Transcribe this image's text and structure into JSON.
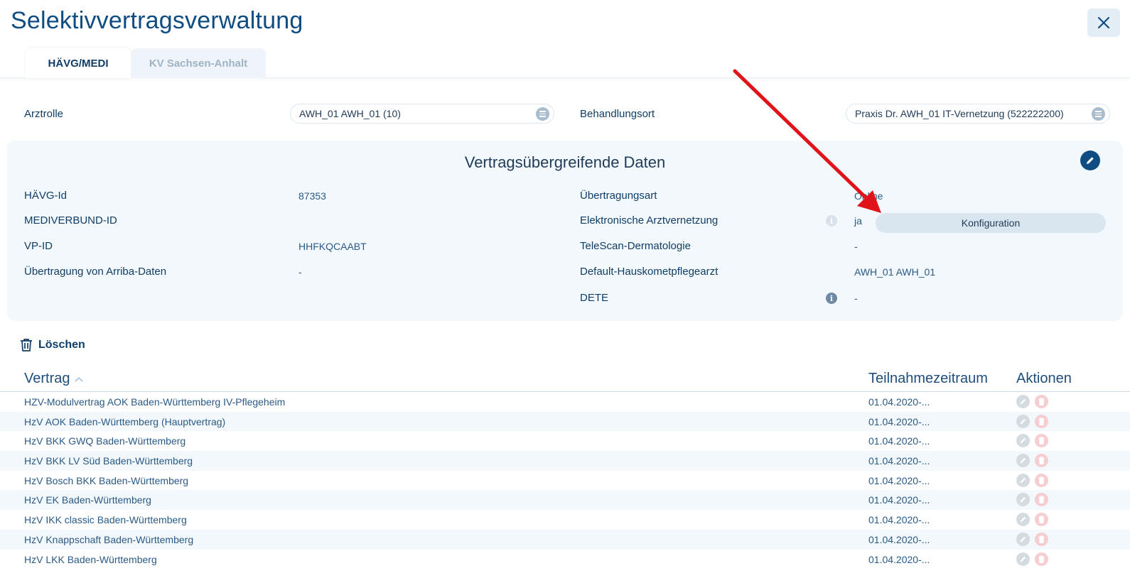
{
  "window": {
    "title": "Selektivvertragsverwaltung"
  },
  "tabs": [
    {
      "label": "HÄVG/MEDI",
      "active": true
    },
    {
      "label": "KV Sachsen-Anhalt",
      "active": false
    }
  ],
  "filters": {
    "arztrolle_label": "Arztrolle",
    "arztrolle_value": "AWH_01 AWH_01 (10)",
    "behandlungsort_label": "Behandlungsort",
    "behandlungsort_value": "Praxis Dr. AWH_01 IT-Vernetzung (522222200)"
  },
  "panel": {
    "title": "Vertragsübergreifende Daten",
    "left": [
      {
        "label": "HÄVG-Id",
        "value": "87353"
      },
      {
        "label": "MEDIVERBUND-ID",
        "value": ""
      },
      {
        "label": "VP-ID",
        "value": "HHFKQCAABT"
      },
      {
        "label": "Übertragung von Arriba-Daten",
        "value": "-"
      }
    ],
    "right": [
      {
        "label": "Übertragungsart",
        "value": "Online"
      },
      {
        "label": "Elektronische Arztvernetzung",
        "value": "ja"
      },
      {
        "label": "TeleScan-Dermatologie",
        "value": "-"
      },
      {
        "label": "Default-Hauskometpflegearzt",
        "value": "AWH_01 AWH_01"
      },
      {
        "label": "DETE",
        "value": "-"
      }
    ],
    "konfiguration_label": "Konfiguration"
  },
  "toolbar": {
    "delete_label": "Löschen"
  },
  "table": {
    "col_vertrag": "Vertrag",
    "col_zeitraum": "Teilnahmezeitraum",
    "col_aktionen": "Aktionen",
    "rows": [
      {
        "name": "HZV-Modulvertrag AOK Baden-Württemberg IV-Pflegeheim",
        "date": "01.04.2020-..."
      },
      {
        "name": "HzV AOK Baden-Württemberg (Hauptvertrag)",
        "date": "01.04.2020-..."
      },
      {
        "name": "HzV BKK GWQ Baden-Württemberg",
        "date": "01.04.2020-..."
      },
      {
        "name": "HzV BKK LV Süd Baden-Württemberg",
        "date": "01.04.2020-..."
      },
      {
        "name": "HzV Bosch BKK Baden-Württemberg",
        "date": "01.04.2020-..."
      },
      {
        "name": "HzV EK Baden-Württemberg",
        "date": "01.04.2020-..."
      },
      {
        "name": "HzV IKK classic Baden-Württemberg",
        "date": "01.04.2020-..."
      },
      {
        "name": "HzV Knappschaft Baden-Württemberg",
        "date": "01.04.2020-..."
      },
      {
        "name": "HzV LKK Baden-Württemberg",
        "date": "01.04.2020-..."
      }
    ]
  },
  "colors": {
    "accent": "#0f4c81",
    "annotation_arrow": "#e0131a",
    "delete_icon": "#f6cdd0"
  }
}
